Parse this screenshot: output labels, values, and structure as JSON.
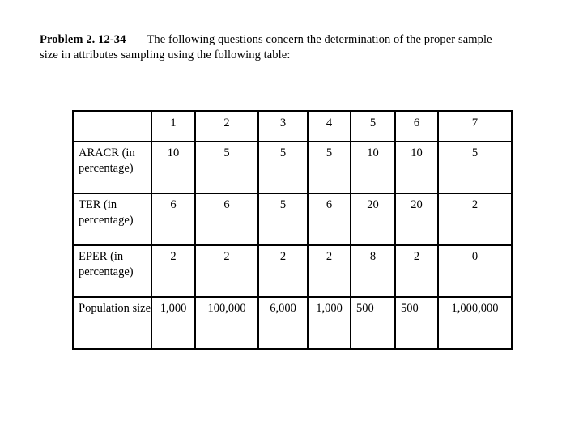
{
  "problem": {
    "label": "Problem 2. 12-34",
    "text_line1": "The following questions concern the determination of the proper sample",
    "text_line2": "size in attributes sampling using the following table:"
  },
  "table": {
    "corner": "",
    "columns": [
      "1",
      "2",
      "3",
      "4",
      "5",
      "6",
      "7"
    ],
    "rows": [
      {
        "label": "ARACR (in percentage)",
        "values": [
          "10",
          "5",
          "5",
          "5",
          "10",
          "10",
          "5"
        ]
      },
      {
        "label": "TER (in percentage)",
        "values": [
          "6",
          "6",
          "5",
          "6",
          "20",
          "20",
          "2"
        ]
      },
      {
        "label": "EPER (in percentage)",
        "values": [
          "2",
          "2",
          "2",
          "2",
          "8",
          "2",
          "0"
        ]
      },
      {
        "label": "Population size",
        "values": [
          "1,000",
          "100,000",
          "6,000",
          "1,000",
          "500",
          "500",
          "1,000,000"
        ]
      }
    ]
  }
}
